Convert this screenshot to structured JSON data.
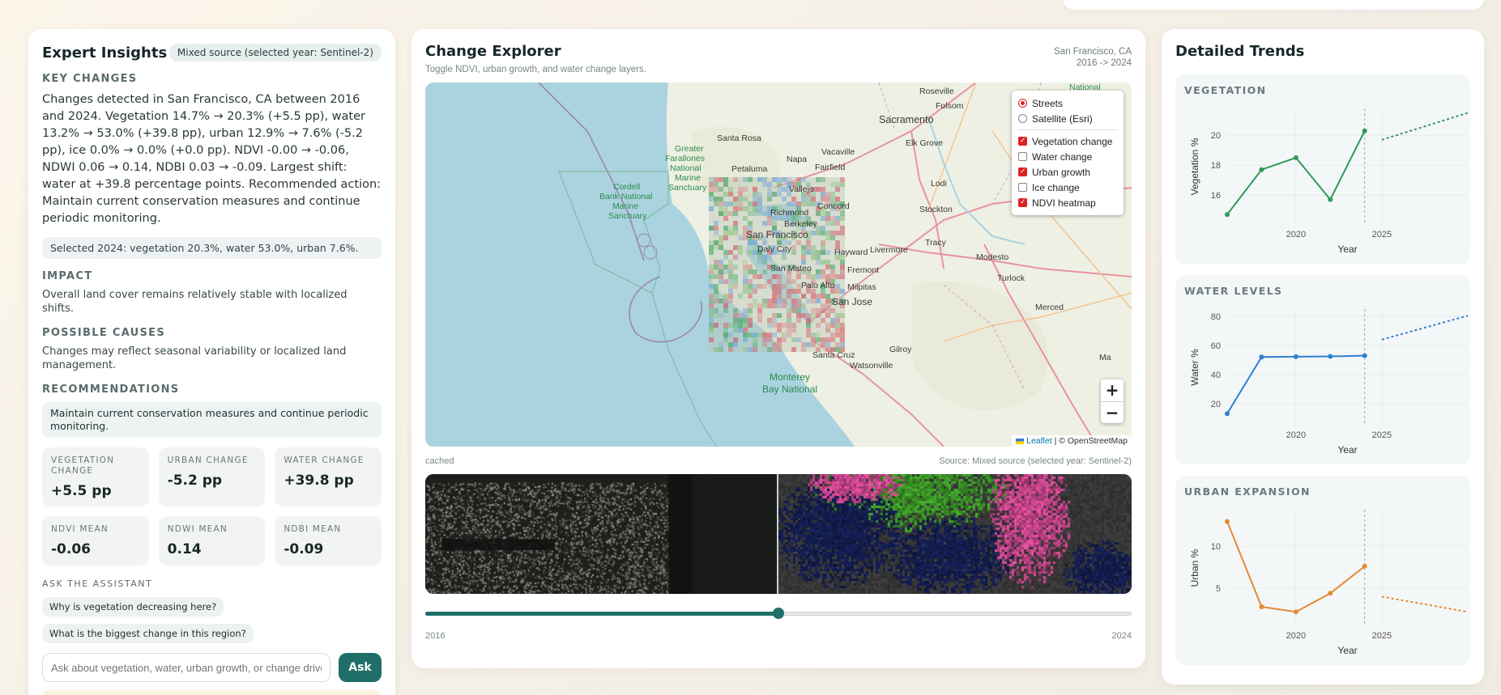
{
  "insights": {
    "title": "Expert Insights",
    "source_badge": "Mixed source (selected year: Sentinel-2)",
    "key_changes_label": "KEY CHANGES",
    "key_changes_text": "Changes detected in San Francisco, CA between 2016 and 2024. Vegetation 14.7% → 20.3% (+5.5 pp), water 13.2% → 53.0% (+39.8 pp), urban 12.9% → 7.6% (-5.2 pp), ice 0.0% → 0.0% (+0.0 pp). NDVI -0.00 → -0.06, NDWI 0.06 → 0.14, NDBI 0.03 → -0.09. Largest shift: water at +39.8 percentage points. Recommended action: Maintain current conservation measures and continue periodic monitoring.",
    "selected_summary": "Selected 2024: vegetation 20.3%, water 53.0%, urban 7.6%.",
    "impact_label": "IMPACT",
    "impact_text": "Overall land cover remains relatively stable with localized shifts.",
    "causes_label": "POSSIBLE CAUSES",
    "causes_text": "Changes may reflect seasonal variability or localized land management.",
    "recommendations_label": "RECOMMENDATIONS",
    "recommendation_text": "Maintain current conservation measures and continue periodic monitoring.",
    "metrics": [
      {
        "label": "VEGETATION CHANGE",
        "value": "+5.5 pp"
      },
      {
        "label": "URBAN CHANGE",
        "value": "-5.2 pp"
      },
      {
        "label": "WATER CHANGE",
        "value": "+39.8 pp"
      },
      {
        "label": "NDVI MEAN",
        "value": "-0.06"
      },
      {
        "label": "NDWI MEAN",
        "value": "0.14"
      },
      {
        "label": "NDBI MEAN",
        "value": "-0.09"
      }
    ],
    "ask_label": "ASK THE ASSISTANT",
    "suggestions": [
      "Why is vegetation decreasing here?",
      "What is the biggest change in this region?"
    ],
    "ask_placeholder": "Ask about vegetation, water, urban growth, or change drivers",
    "ask_button": "Ask"
  },
  "explorer": {
    "title": "Change Explorer",
    "subtitle": "Toggle NDVI, urban growth, and water change layers.",
    "location": "San Francisco, CA",
    "range": "2016 -> 2024",
    "base_layers": [
      {
        "label": "Streets",
        "selected": true
      },
      {
        "label": "Satellite (Esri)",
        "selected": false
      }
    ],
    "overlays": [
      {
        "label": "Vegetation change",
        "checked": true
      },
      {
        "label": "Water change",
        "checked": false
      },
      {
        "label": "Urban growth",
        "checked": true
      },
      {
        "label": "Ice change",
        "checked": false
      },
      {
        "label": "NDVI heatmap",
        "checked": true
      }
    ],
    "zoom_in": "+",
    "zoom_out": "−",
    "attribution_leaflet": "Leaflet",
    "attribution_rest": "| © OpenStreetMap",
    "map_labels": [
      "Roseville",
      "National",
      "Folsom",
      "Sacramento",
      "Santa Rosa",
      "Greater",
      "Farallones",
      "National",
      "Marine",
      "Sanctuary",
      "Vacaville",
      "Elk Grove",
      "Petaluma",
      "Napa",
      "Fairfield",
      "Cordell",
      "Bank National",
      "Marine",
      "Sanctuary",
      "Vallejo",
      "Lodi",
      "Concord",
      "Richmond",
      "Berkeley",
      "Stockton",
      "San Francisco",
      "Daly City",
      "Hayward",
      "Livermore",
      "Tracy",
      "San Mateo",
      "Fremont",
      "Modesto",
      "Palo Alto",
      "Milpitas",
      "Turlock",
      "San Jose",
      "Merced",
      "Santa Cruz",
      "Gilroy",
      "Watsonville",
      "Monterey",
      "Bay National",
      "Ma"
    ],
    "status": "cached",
    "source": "Source: Mixed source (selected year: Sentinel-2)",
    "slider_start": "2016",
    "slider_end": "2024",
    "slider_fraction": 0.5
  },
  "trends": {
    "title": "Detailed Trends",
    "colors": {
      "vegetation": "#2e9a57",
      "water": "#2f7fd0",
      "urban": "#e38a35"
    }
  },
  "chart_data": [
    {
      "type": "line",
      "title": "VEGETATION",
      "xlabel": "Year",
      "ylabel": "Vegetation %",
      "x": [
        2016,
        2018,
        2020,
        2022,
        2024
      ],
      "series": [
        {
          "values": [
            14.7,
            17.7,
            18.5,
            15.7,
            20.3
          ]
        }
      ],
      "forecast": {
        "x": [
          2025,
          2030
        ],
        "values": [
          19.7,
          21.5
        ]
      },
      "ylim": [
        14,
        21.8
      ],
      "yticks": [
        16,
        18,
        20
      ],
      "xticks": [
        2020,
        2025
      ],
      "xlim": [
        2016,
        2030
      ]
    },
    {
      "type": "line",
      "title": "WATER LEVELS",
      "xlabel": "Year",
      "ylabel": "Water %",
      "x": [
        2016,
        2018,
        2020,
        2022,
        2024
      ],
      "series": [
        {
          "values": [
            13.2,
            52.1,
            52.3,
            52.5,
            53.0
          ]
        }
      ],
      "forecast": {
        "x": [
          2025,
          2030
        ],
        "values": [
          64,
          80.5
        ]
      },
      "ylim": [
        5,
        85
      ],
      "yticks": [
        20,
        40,
        60,
        80
      ],
      "xticks": [
        2020,
        2025
      ],
      "xlim": [
        2016,
        2030
      ]
    },
    {
      "type": "line",
      "title": "URBAN EXPANSION",
      "xlabel": "Year",
      "ylabel": "Urban %",
      "x": [
        2016,
        2018,
        2020,
        2022,
        2024
      ],
      "series": [
        {
          "values": [
            12.9,
            2.8,
            2.2,
            4.4,
            7.6
          ]
        }
      ],
      "forecast": {
        "x": [
          2025,
          2030
        ],
        "values": [
          4.0,
          2.2
        ]
      },
      "ylim": [
        0.5,
        14.3
      ],
      "yticks": [
        5,
        10
      ],
      "xticks": [
        2020,
        2025
      ],
      "xlim": [
        2016,
        2030
      ]
    }
  ]
}
